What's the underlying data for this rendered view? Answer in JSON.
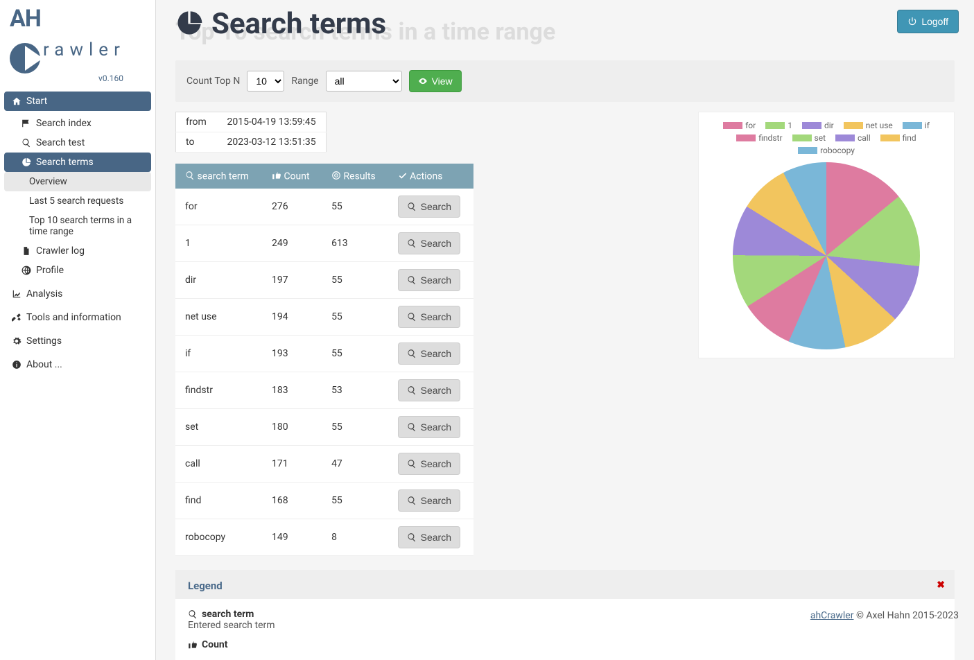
{
  "app": {
    "name_prefix": "AH",
    "name_suffix": "rawler",
    "version": "v0.160"
  },
  "nav": {
    "start": "Start",
    "search_index": "Search index",
    "search_test": "Search test",
    "search_terms": "Search terms",
    "overview": "Overview",
    "last5": "Last 5 search requests",
    "top10": "Top 10 search terms in a time range",
    "crawler_log": "Crawler log",
    "profile": "Profile",
    "analysis": "Analysis",
    "tools": "Tools and information",
    "settings": "Settings",
    "about": "About ..."
  },
  "header": {
    "ghost": "Top 10 search terms in a time range",
    "title": "Search terms",
    "logoff": "Logoff"
  },
  "filter": {
    "count_label": "Count Top N",
    "count_value": "10",
    "range_label": "Range",
    "range_value": "all",
    "view_btn": "View"
  },
  "range": {
    "from_label": "from",
    "from_value": "2015-04-19 13:59:45",
    "to_label": "to",
    "to_value": "2023-03-12 13:51:35"
  },
  "columns": {
    "term": "search term",
    "count": "Count",
    "results": "Results",
    "actions": "Actions"
  },
  "rows": [
    {
      "term": "for",
      "count": "276",
      "results": "55",
      "action": "Search"
    },
    {
      "term": "1",
      "count": "249",
      "results": "613",
      "action": "Search"
    },
    {
      "term": "dir",
      "count": "197",
      "results": "55",
      "action": "Search"
    },
    {
      "term": "net use",
      "count": "194",
      "results": "55",
      "action": "Search"
    },
    {
      "term": "if",
      "count": "193",
      "results": "55",
      "action": "Search"
    },
    {
      "term": "findstr",
      "count": "183",
      "results": "53",
      "action": "Search"
    },
    {
      "term": "set",
      "count": "180",
      "results": "55",
      "action": "Search"
    },
    {
      "term": "call",
      "count": "171",
      "results": "47",
      "action": "Search"
    },
    {
      "term": "find",
      "count": "168",
      "results": "55",
      "action": "Search"
    },
    {
      "term": "robocopy",
      "count": "149",
      "results": "8",
      "action": "Search"
    }
  ],
  "legend_section": {
    "title": "Legend",
    "item1_title": "search term",
    "item1_desc": "Entered search term",
    "item2_title": "Count"
  },
  "footer": {
    "link": "ahCrawler",
    "copy": " © Axel Hahn 2015-2023"
  },
  "chart_data": {
    "type": "pie",
    "title": "",
    "series": [
      {
        "name": "for",
        "value": 276,
        "color": "#de7ba0"
      },
      {
        "name": "1",
        "value": 249,
        "color": "#a3d87b"
      },
      {
        "name": "dir",
        "value": 197,
        "color": "#9d89d8"
      },
      {
        "name": "net use",
        "value": 194,
        "color": "#f2c55e"
      },
      {
        "name": "if",
        "value": 193,
        "color": "#7ab7d8"
      },
      {
        "name": "findstr",
        "value": 183,
        "color": "#de7ba0"
      },
      {
        "name": "set",
        "value": 180,
        "color": "#a3d87b"
      },
      {
        "name": "call",
        "value": 171,
        "color": "#9d89d8"
      },
      {
        "name": "find",
        "value": 168,
        "color": "#f2c55e"
      },
      {
        "name": "robocopy",
        "value": 149,
        "color": "#7ab7d8"
      }
    ]
  }
}
